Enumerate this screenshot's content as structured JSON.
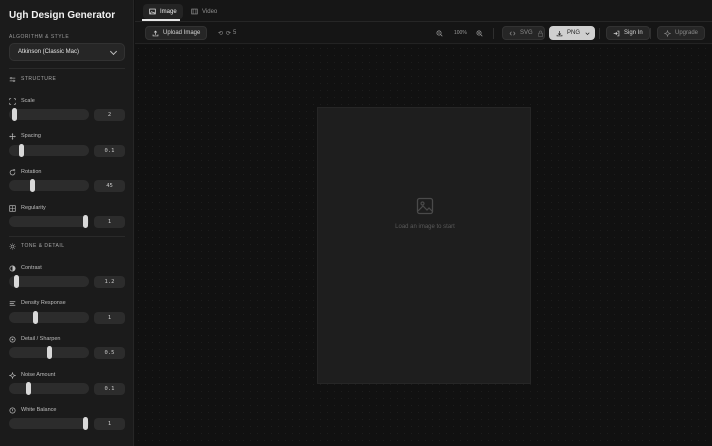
{
  "app": {
    "title": "Ugh Design Generator"
  },
  "algorithm": {
    "label": "ALGORITHM & STYLE",
    "selected": "Atkinson (Classic Mac)"
  },
  "sections": {
    "structure": "STRUCTURE",
    "tone": "TONE & DETAIL"
  },
  "params": {
    "scale": {
      "label": "Scale",
      "value": "2",
      "level": 0.03
    },
    "spacing": {
      "label": "Spacing",
      "value": "0.1",
      "level": 0.12
    },
    "rotation": {
      "label": "Rotation",
      "value": "45",
      "level": 0.28
    },
    "regularity": {
      "label": "Regularity",
      "value": "1",
      "level": 1.0
    },
    "contrast": {
      "label": "Contrast",
      "value": "1.2",
      "level": 0.05
    },
    "density": {
      "label": "Density Response",
      "value": "1",
      "level": 0.32
    },
    "detail": {
      "label": "Detail / Sharpen",
      "value": "0.5",
      "level": 0.5
    },
    "noise": {
      "label": "Noise Amount",
      "value": "0.1",
      "level": 0.22
    },
    "white": {
      "label": "White Balance",
      "value": "1",
      "level": 1.0
    }
  },
  "tabs": [
    {
      "label": "Image",
      "active": true
    },
    {
      "label": "Video",
      "active": false
    }
  ],
  "toolbar": {
    "upload": "Upload Image",
    "undo": "⟲",
    "redo": "⟳",
    "history": "5",
    "zoom": "100%",
    "svg": "SVG",
    "png": "PNG",
    "signin": "Sign In",
    "upgrade": "Upgrade"
  },
  "canvas": {
    "placeholder": "Load an image to start"
  },
  "colors": {
    "background": "#121212",
    "sidebar": "#1b1b1b",
    "accent": "#d9d9d9"
  }
}
